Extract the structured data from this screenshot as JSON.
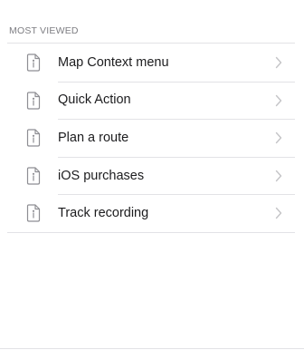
{
  "section": {
    "title": "MOST VIEWED"
  },
  "items": [
    {
      "label": "Map Context menu",
      "icon": "document-info-icon"
    },
    {
      "label": "Quick Action",
      "icon": "document-info-icon"
    },
    {
      "label": "Plan a route",
      "icon": "document-info-icon"
    },
    {
      "label": "iOS purchases",
      "icon": "document-info-icon"
    },
    {
      "label": "Track recording",
      "icon": "document-info-icon"
    }
  ],
  "colors": {
    "icon": "#8e8e93",
    "chevron": "#c4c4c7",
    "separator": "#e2e2e6",
    "header_text": "#7d7d82",
    "label_text": "#1c1c1e"
  }
}
